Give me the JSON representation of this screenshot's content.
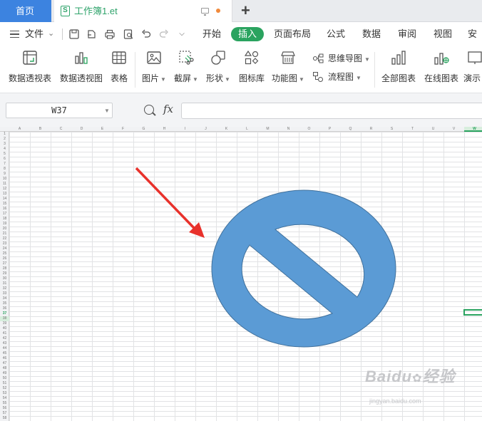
{
  "tabs": {
    "home": "首页",
    "document": "工作簿1.et",
    "doc_icon_letter": "S"
  },
  "menu": {
    "file": "文件",
    "tabs": [
      "开始",
      "插入",
      "页面布局",
      "公式",
      "数据",
      "审阅",
      "视图",
      "安全"
    ],
    "active_tab": "插入",
    "accent_color": "#2aa35f"
  },
  "ribbon": {
    "pivot_table": "数据透视表",
    "pivot_chart": "数据透视图",
    "table": "表格",
    "picture": "图片",
    "screenshot": "截屏",
    "shapes": "形状",
    "icon_library": "图标库",
    "function_chart": "功能图",
    "mind_map": "思维导图",
    "flowchart": "流程图",
    "all_charts": "全部图表",
    "online_charts": "在线图表",
    "demo": "演示"
  },
  "formula_bar": {
    "cell_ref": "W37",
    "fx": "fx",
    "value": ""
  },
  "sheet": {
    "columns": [
      "A",
      "B",
      "C",
      "D",
      "E",
      "F",
      "G",
      "H",
      "I",
      "J",
      "K",
      "L",
      "M",
      "N",
      "O",
      "P",
      "Q",
      "R",
      "S",
      "T",
      "U",
      "V",
      "W"
    ],
    "row_count": 58,
    "active_row": 37,
    "active_column": "W"
  },
  "shape": {
    "type": "no-symbol",
    "fill": "#5b9bd5",
    "stroke": "#41719c"
  },
  "annotation": {
    "arrow_color": "#e8312b"
  },
  "watermark": {
    "brand": "Baidu",
    "suffix": "经验",
    "url": "jingyan.baidu.com"
  }
}
